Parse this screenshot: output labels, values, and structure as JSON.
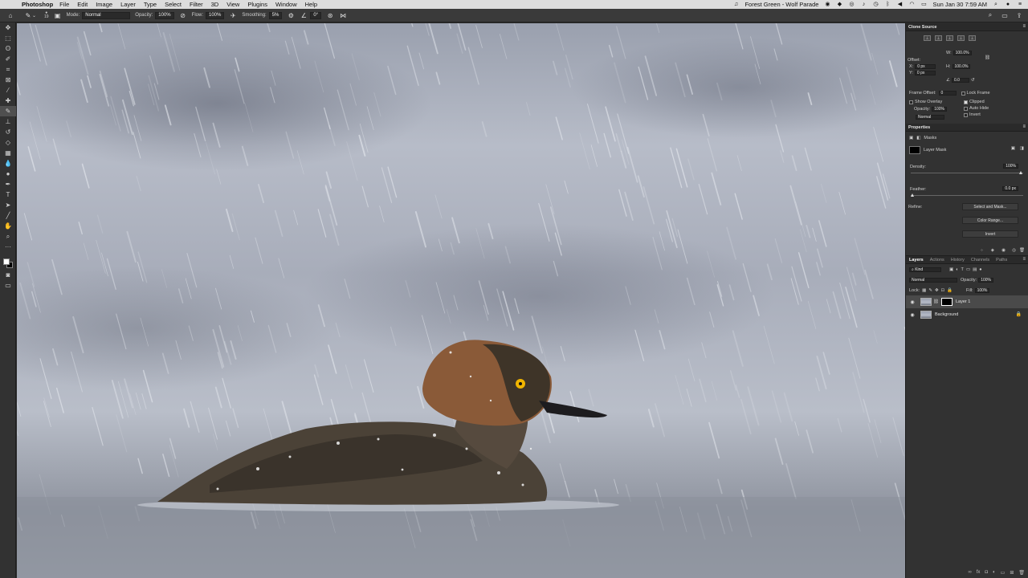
{
  "menubar": {
    "app_name": "Photoshop",
    "menus": [
      "File",
      "Edit",
      "Image",
      "Layer",
      "Type",
      "Select",
      "Filter",
      "3D",
      "View",
      "Plugins",
      "Window",
      "Help"
    ],
    "now_playing": "Forest Green - Wolf Parade",
    "datetime": "Sun Jan 30  7:59 AM"
  },
  "options_bar": {
    "brush_size": "19",
    "mode_label": "Mode:",
    "mode_value": "Normal",
    "opacity_label": "Opacity:",
    "opacity_value": "100%",
    "flow_label": "Flow:",
    "flow_value": "100%",
    "smoothing_label": "Smoothing:",
    "smoothing_value": "5%",
    "angle_value": "0°"
  },
  "clone_source": {
    "title": "Clone Source",
    "offset_label": "Offset:",
    "x_label": "X:",
    "x_value": "0 px",
    "y_label": "Y:",
    "y_value": "0 px",
    "w_label": "W:",
    "w_value": "100.0%",
    "h_label": "H:",
    "h_value": "100.0%",
    "angle_value": "0.0",
    "frame_offset_label": "Frame Offset:",
    "frame_offset_value": "0",
    "lock_frame_label": "Lock Frame",
    "show_overlay_label": "Show Overlay",
    "opacity_label": "Opacity:",
    "opacity_value": "100%",
    "blend_value": "Normal",
    "clipped_label": "Clipped",
    "auto_hide_label": "Auto Hide",
    "invert_label": "Invert"
  },
  "properties": {
    "title": "Properties",
    "masks_label": "Masks",
    "layer_mask_label": "Layer Mask",
    "density_label": "Density:",
    "density_value": "100%",
    "density_level": 1.0,
    "feather_label": "Feather:",
    "feather_value": "0.0 px",
    "feather_level": 0.0,
    "refine_label": "Refine:",
    "select_and_mask": "Select and Mask...",
    "color_range": "Color Range...",
    "invert": "Invert"
  },
  "layers_panel": {
    "tabs": [
      "Layers",
      "Actions",
      "History",
      "Channels",
      "Paths"
    ],
    "filter_label": "Kind",
    "blend_mode": "Normal",
    "opacity_label": "Opacity:",
    "opacity_value": "100%",
    "lock_label": "Lock:",
    "fill_label": "Fill:",
    "fill_value": "100%",
    "layers": [
      {
        "name": "Layer 1",
        "selected": true
      },
      {
        "name": "Background",
        "selected": false
      }
    ]
  },
  "colors": {
    "accent_eye": "#f0b400",
    "duck_body": "#4b4237",
    "duck_head": "#8a5a38"
  }
}
